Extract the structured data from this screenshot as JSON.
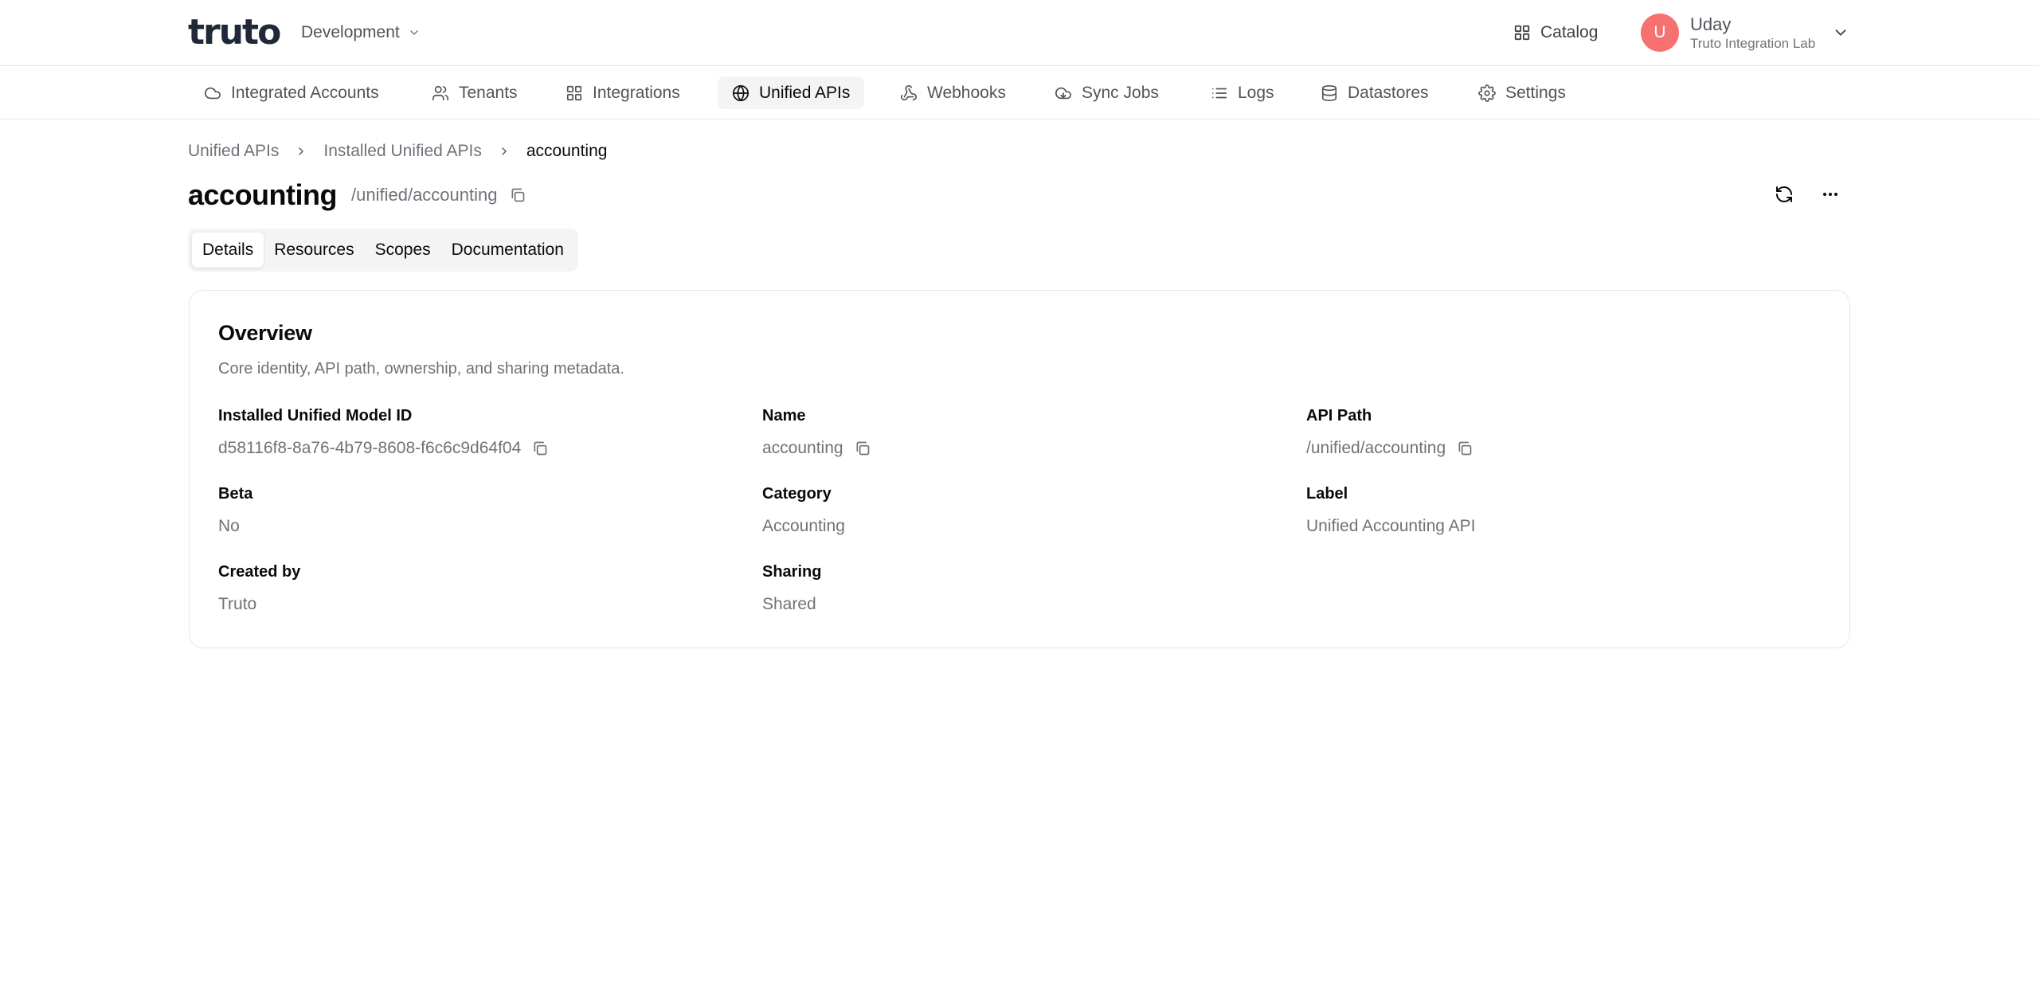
{
  "app": {
    "logo_text": "truto",
    "environment": "Development"
  },
  "topbar": {
    "catalog_label": "Catalog",
    "user": {
      "initial": "U",
      "name": "Uday",
      "org": "Truto Integration Lab"
    }
  },
  "nav": {
    "items": [
      {
        "label": "Integrated Accounts",
        "icon": "cloud-icon"
      },
      {
        "label": "Tenants",
        "icon": "users-icon"
      },
      {
        "label": "Integrations",
        "icon": "grid-icon"
      },
      {
        "label": "Unified APIs",
        "icon": "globe-icon",
        "active": true
      },
      {
        "label": "Webhooks",
        "icon": "webhook-icon"
      },
      {
        "label": "Sync Jobs",
        "icon": "sync-icon"
      },
      {
        "label": "Logs",
        "icon": "list-icon"
      },
      {
        "label": "Datastores",
        "icon": "database-icon"
      },
      {
        "label": "Settings",
        "icon": "gear-icon"
      }
    ]
  },
  "breadcrumb": [
    "Unified APIs",
    "Installed Unified APIs",
    "accounting"
  ],
  "page": {
    "title": "accounting",
    "path": "/unified/accounting"
  },
  "tabs": [
    {
      "label": "Details",
      "active": true
    },
    {
      "label": "Resources"
    },
    {
      "label": "Scopes"
    },
    {
      "label": "Documentation"
    }
  ],
  "overview": {
    "title": "Overview",
    "description": "Core identity, API path, ownership, and sharing metadata.",
    "fields": {
      "model_id": {
        "label": "Installed Unified Model ID",
        "value": "d58116f8-8a76-4b79-8608-f6c6c9d64f04"
      },
      "name": {
        "label": "Name",
        "value": "accounting"
      },
      "api_path": {
        "label": "API Path",
        "value": "/unified/accounting"
      },
      "beta": {
        "label": "Beta",
        "value": "No"
      },
      "category": {
        "label": "Category",
        "value": "Accounting"
      },
      "label": {
        "label": "Label",
        "value": "Unified Accounting API"
      },
      "created_by": {
        "label": "Created by",
        "value": "Truto"
      },
      "sharing": {
        "label": "Sharing",
        "value": "Shared"
      }
    }
  },
  "colors": {
    "avatar": "#f87171",
    "active_nav_bg": "#f4f4f5",
    "muted_text": "#71717a",
    "border": "#e5e7eb"
  }
}
